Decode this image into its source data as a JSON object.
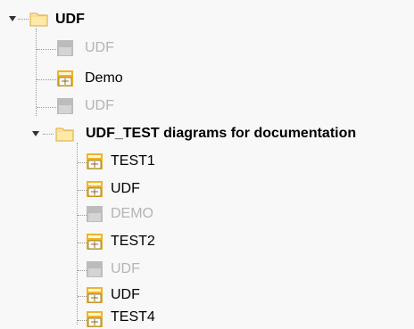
{
  "tree": {
    "root": {
      "label": "UDF",
      "expanded": true,
      "icon": "folder-icon",
      "children": [
        {
          "label": "UDF",
          "state": "disabled",
          "icon": "udf-diagram-icon"
        },
        {
          "label": "Demo",
          "state": "enabled",
          "icon": "udf-diagram-icon"
        },
        {
          "label": "UDF",
          "state": "disabled",
          "icon": "udf-diagram-icon"
        }
      ],
      "subfolder": {
        "label": "UDF_TEST diagrams for documentation",
        "expanded": true,
        "icon": "folder-icon",
        "children": [
          {
            "label": "TEST1",
            "state": "enabled",
            "icon": "udf-diagram-icon"
          },
          {
            "label": "UDF",
            "state": "enabled",
            "icon": "udf-diagram-icon"
          },
          {
            "label": "DEMO",
            "state": "disabled",
            "icon": "udf-diagram-icon"
          },
          {
            "label": "TEST2",
            "state": "enabled",
            "icon": "udf-diagram-icon"
          },
          {
            "label": "UDF",
            "state": "disabled",
            "icon": "udf-diagram-icon"
          },
          {
            "label": "UDF",
            "state": "enabled",
            "icon": "udf-diagram-icon"
          },
          {
            "label": "TEST4",
            "state": "enabled",
            "icon": "udf-diagram-icon"
          }
        ]
      }
    }
  },
  "colors": {
    "background": "#f8f8f8",
    "disabled_text": "#b4b4b4",
    "folder_fill": "#ffe9a8",
    "folder_stroke": "#d9a93c",
    "icon_active": "#f0b429",
    "icon_disabled": "#bcbcbc"
  }
}
